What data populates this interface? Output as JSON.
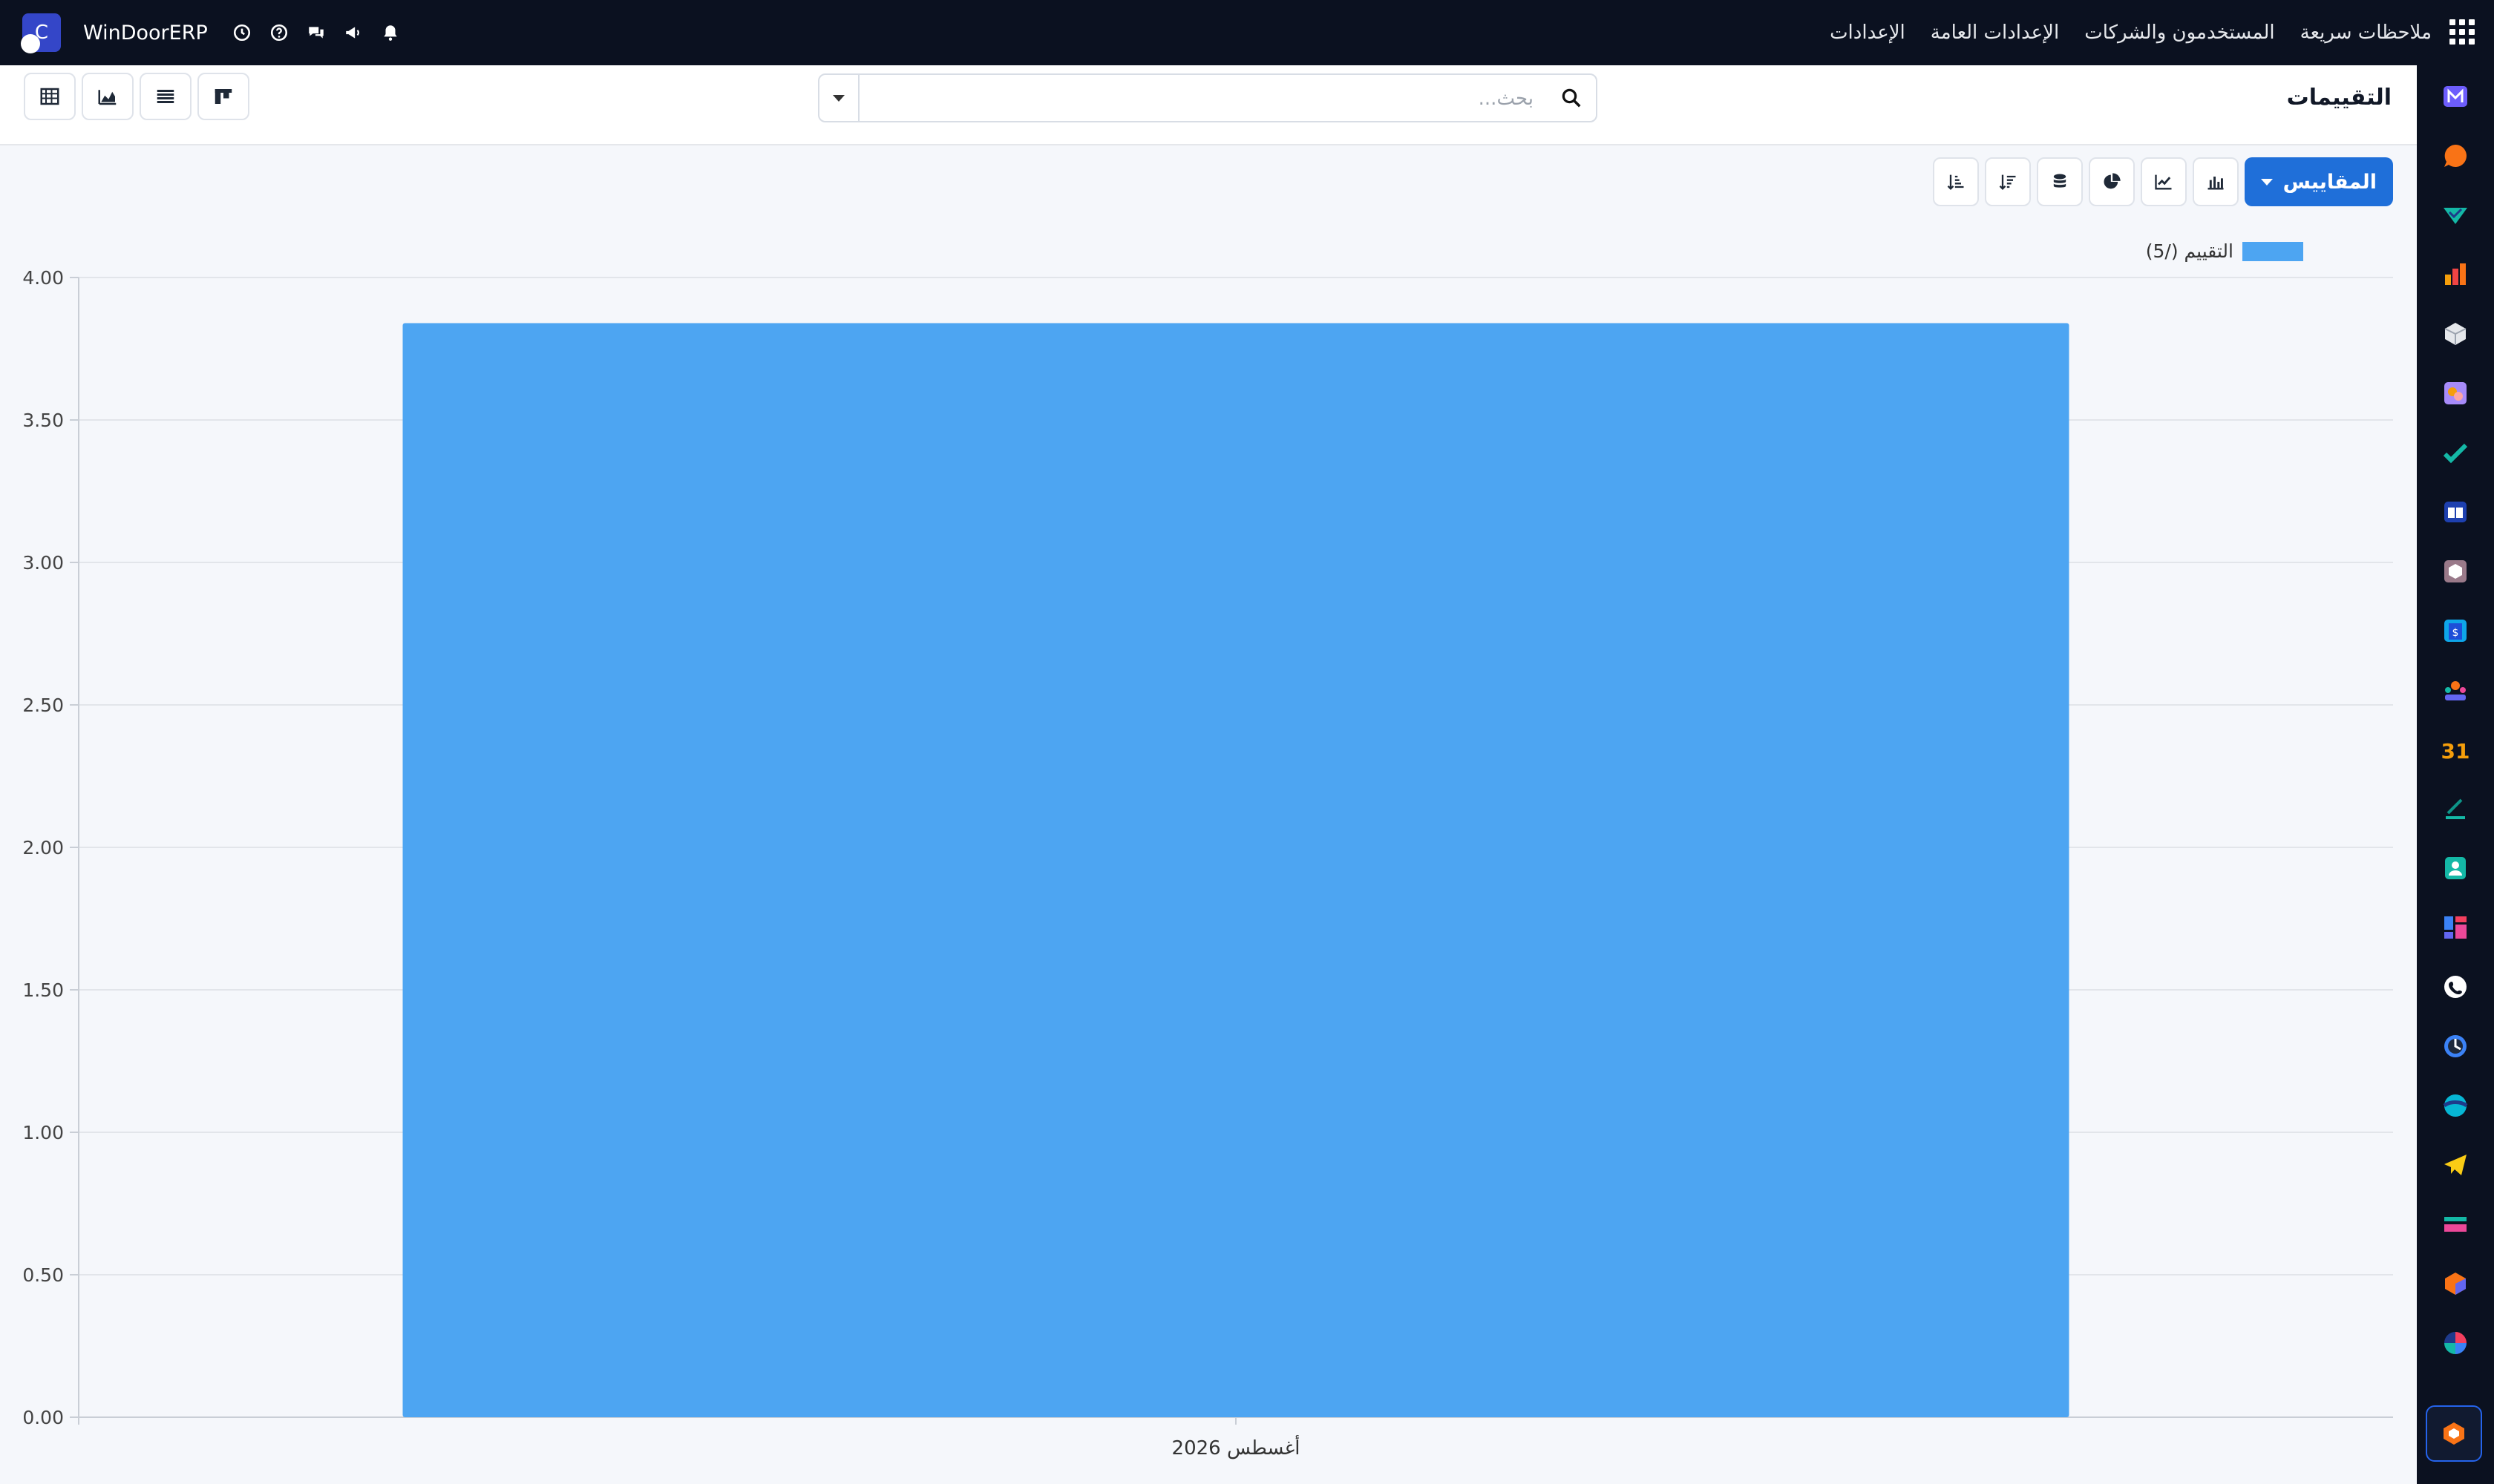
{
  "navbar": {
    "menu": [
      "الإعدادات",
      "الإعدادات العامة",
      "المستخدمون والشركات",
      "ملاحظات سريعة"
    ],
    "brand": "WinDoorERP",
    "brand_logo_letter": "C",
    "icons": [
      "clock-icon",
      "help-icon",
      "chat-icon",
      "megaphone-icon",
      "bell-icon"
    ]
  },
  "control_panel": {
    "title": "التقييمات",
    "search_placeholder": "بحث..."
  },
  "toolbar": {
    "measures_label": "المقاييس"
  },
  "colors": {
    "bar": "#4da5f2",
    "primary": "#1f6fd9",
    "navbar": "#0b1120"
  },
  "chart_data": {
    "type": "bar",
    "categories": [
      "أغسطس 2026"
    ],
    "series": [
      {
        "name": "التقييم (/5)",
        "values": [
          3.84
        ]
      }
    ],
    "ylim": [
      0,
      4
    ],
    "yticks": [
      "0.00",
      "0.50",
      "1.00",
      "1.50",
      "2.00",
      "2.50",
      "3.00",
      "3.50",
      "4.00"
    ],
    "grid": true,
    "legend": "top-right"
  }
}
